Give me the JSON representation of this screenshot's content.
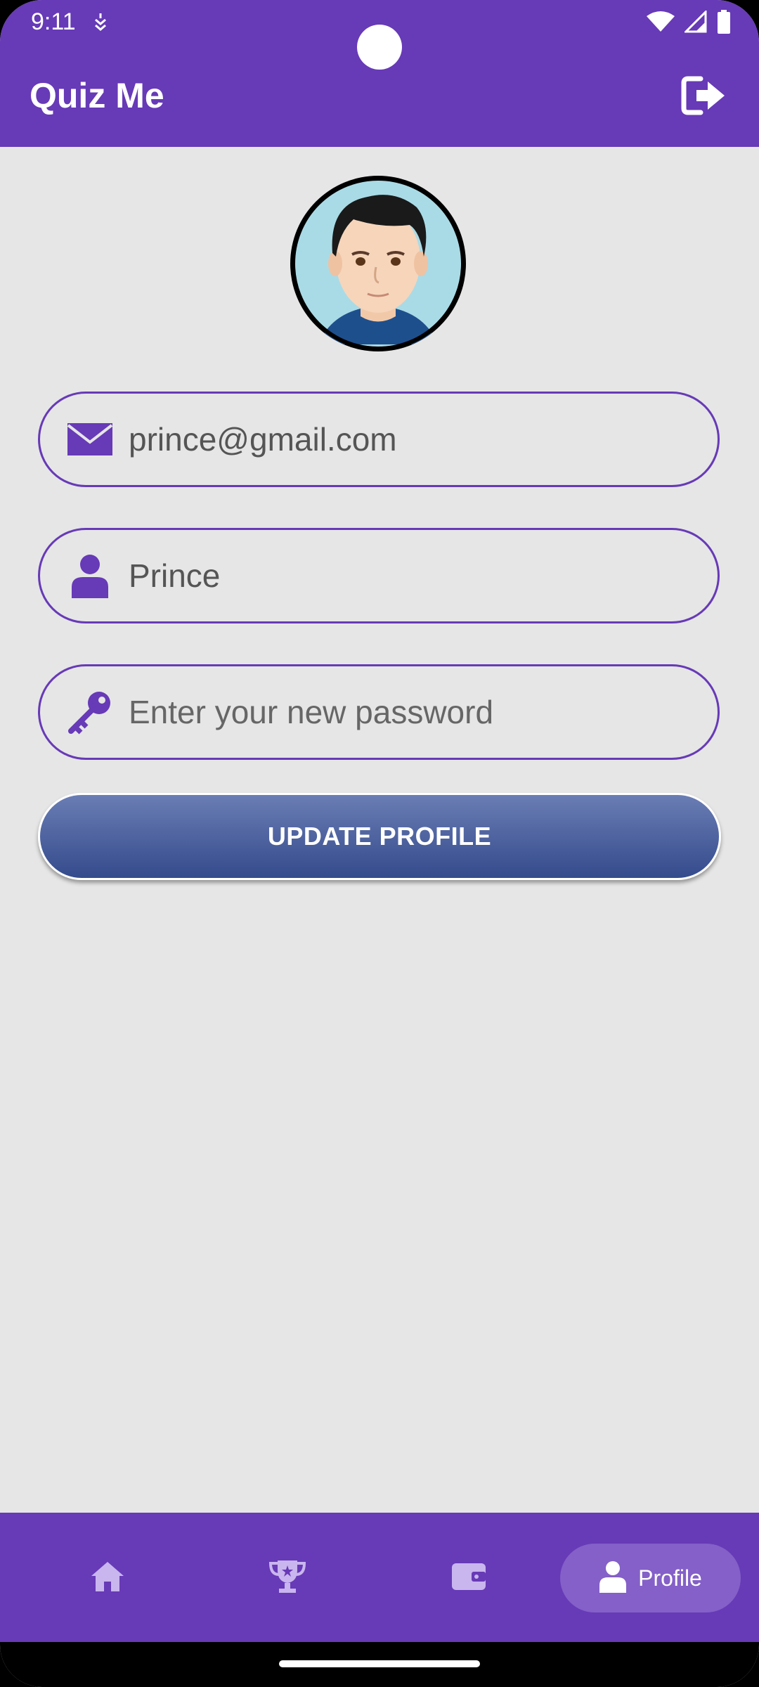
{
  "status_bar": {
    "time": "9:11"
  },
  "app_bar": {
    "title": "Quiz Me",
    "logout_icon": "logout-icon"
  },
  "profile": {
    "email_value": "prince@gmail.com",
    "name_value": "Prince",
    "password_placeholder": "Enter your new password",
    "update_label": "UPDATE PROFILE"
  },
  "bottom_nav": {
    "items": [
      {
        "icon": "home-icon",
        "label": ""
      },
      {
        "icon": "trophy-icon",
        "label": ""
      },
      {
        "icon": "wallet-icon",
        "label": ""
      },
      {
        "icon": "person-icon",
        "label": "Profile"
      }
    ]
  },
  "colors": {
    "primary": "#673ab7",
    "background": "#e6e6e6",
    "button_top": "#6a7db4",
    "button_bottom": "#344b8c",
    "nav_active": "#8460c8",
    "nav_icon": "#c9b6ee"
  }
}
